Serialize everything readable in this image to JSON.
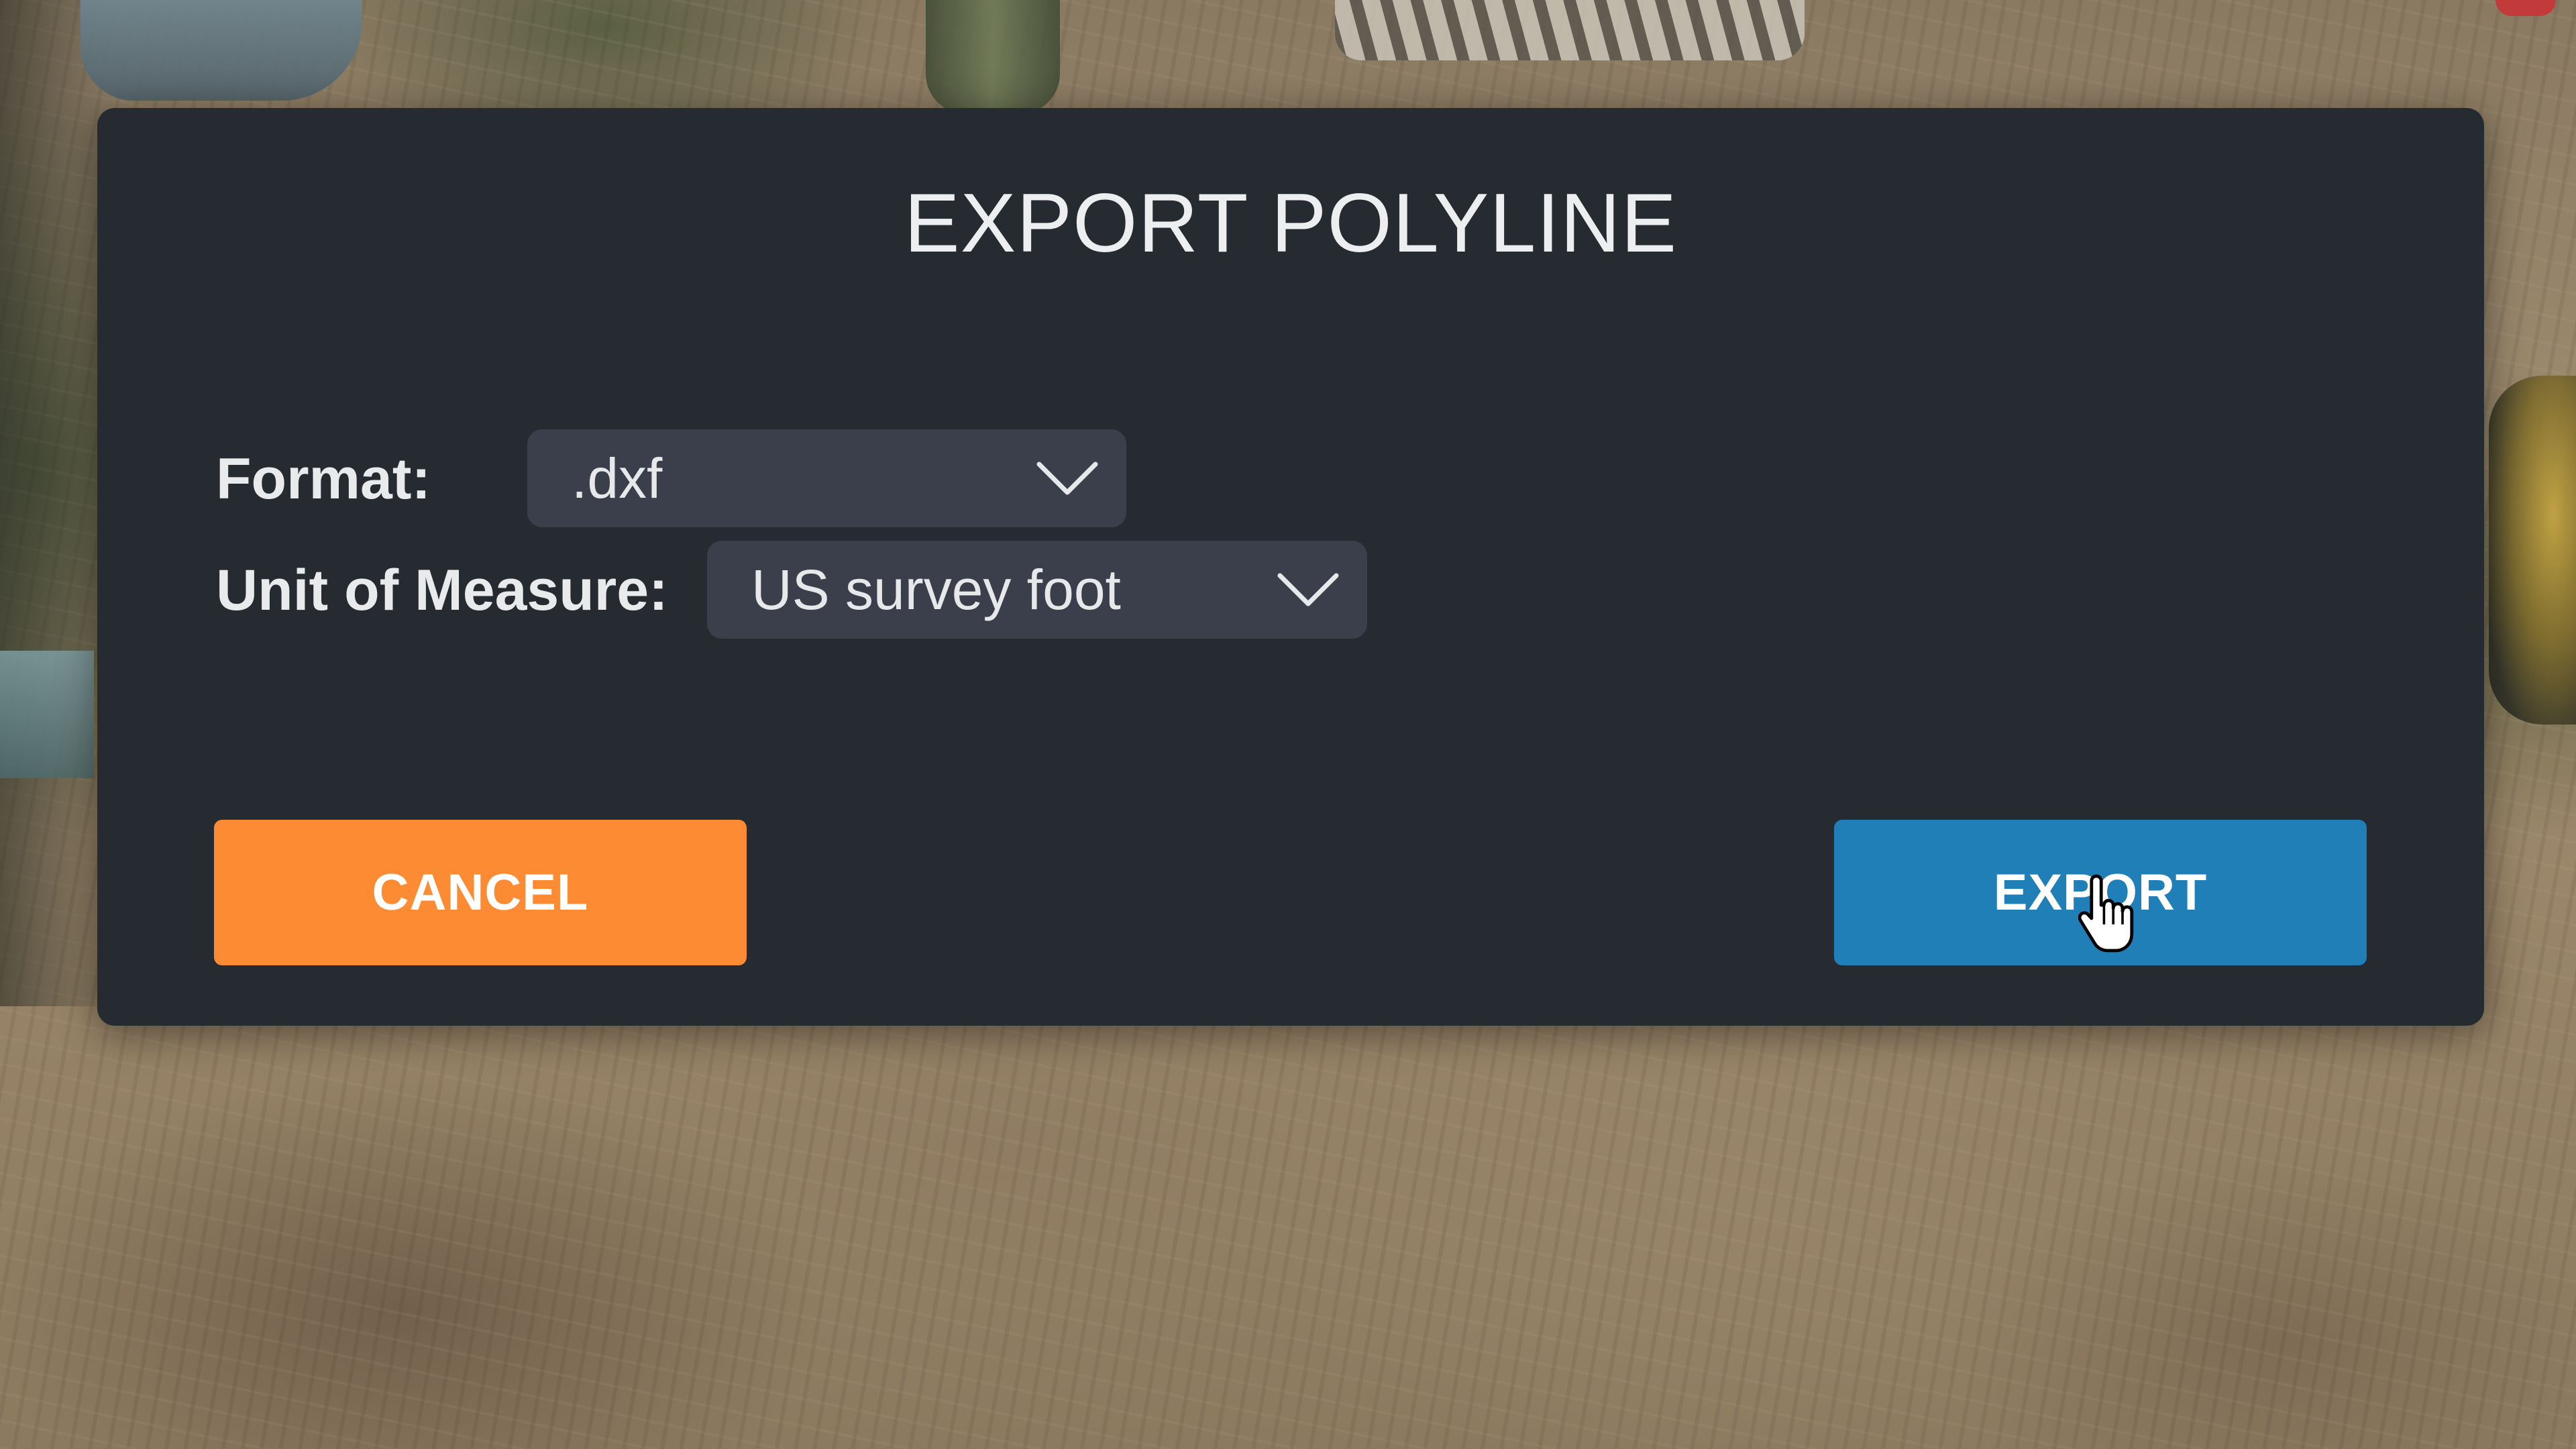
{
  "dialog": {
    "title": "EXPORT POLYLINE",
    "fields": {
      "format": {
        "label": "Format:",
        "value": ".dxf",
        "icon": "chevron-down-icon"
      },
      "unit_of_measure": {
        "label": "Unit of Measure:",
        "value": "US survey foot",
        "icon": "chevron-down-icon"
      }
    },
    "buttons": {
      "cancel_label": "CANCEL",
      "export_label": "EXPORT"
    }
  },
  "pointer": {
    "icon": "hand-pointer-icon",
    "hovering": "export-button"
  },
  "colors": {
    "dialog_background": "#262a31",
    "select_background": "#3b3f4b",
    "cancel_button": "#fd8b34",
    "export_button": "#217fb8",
    "text": "#eceef0"
  }
}
